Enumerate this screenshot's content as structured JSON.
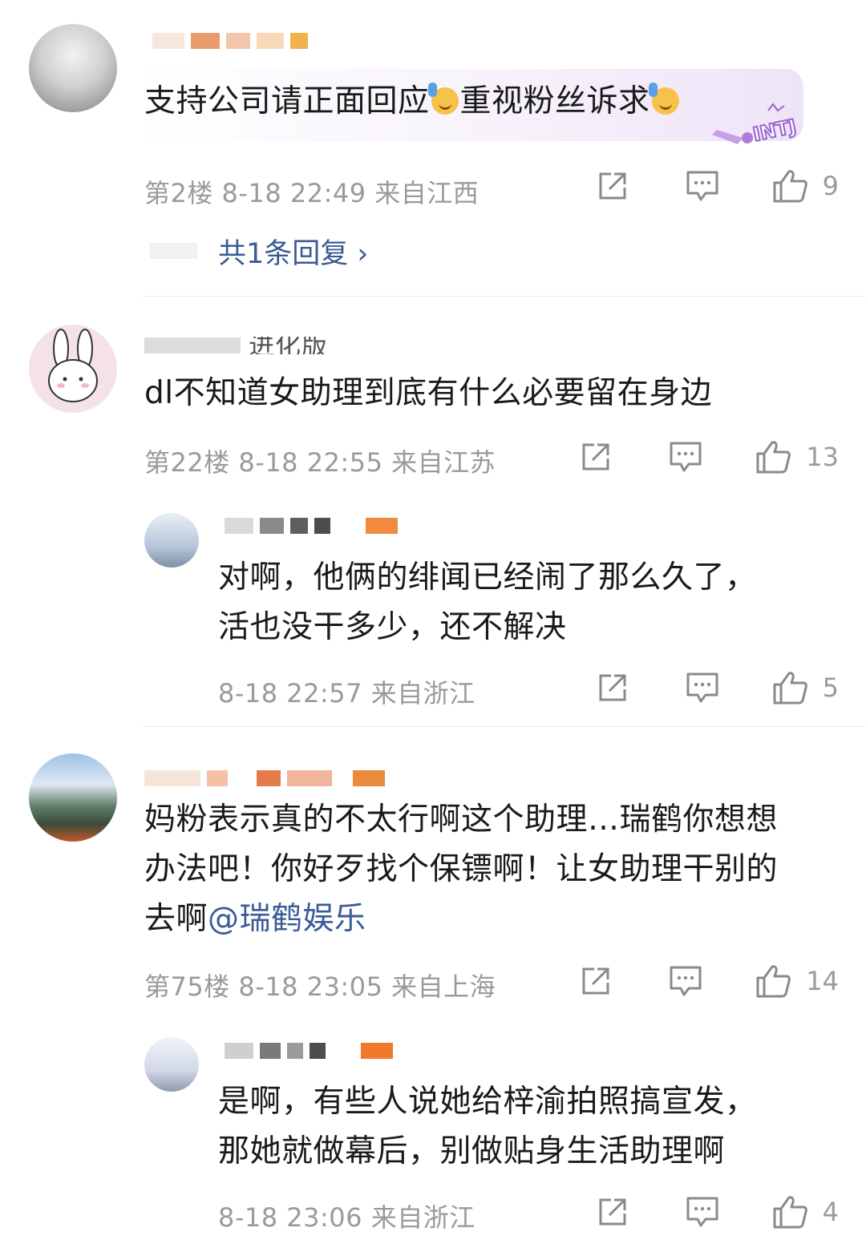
{
  "comments": [
    {
      "text_parts": [
        "支持公司请正面回应",
        "重视粉丝诉求"
      ],
      "floor": "第2楼",
      "time": "8-18 22:49",
      "location": "来自江西",
      "likes": "9",
      "reply_link": "共1条回复 ›",
      "badge": "INTJ"
    },
    {
      "username_partial": "进化版",
      "text": "dl不知道女助理到底有什么必要留在身边",
      "floor": "第22楼",
      "time": "8-18 22:55",
      "location": "来自江苏",
      "likes": "13"
    },
    {
      "text_line1": "对啊，他俩的绯闻已经闹了那么久了，",
      "text_line2": "活也没干多少，还不解决",
      "time": "8-18 22:57",
      "location": "来自浙江",
      "likes": "5"
    },
    {
      "text_line1": "妈粉表示真的不太行啊这个助理…瑞鹤你想想",
      "text_line2": "办法吧！你好歹找个保镖啊！让女助理干别的",
      "text_line3_prefix": "去啊",
      "mention": "@瑞鹤娱乐",
      "floor": "第75楼",
      "time": "8-18 23:05",
      "location": "来自上海",
      "likes": "14"
    },
    {
      "text_line1": "是啊，有些人说她给梓渝拍照搞宣发，",
      "text_line2": "那她就做幕后，别做贴身生活助理啊",
      "time": "8-18 23:06",
      "location": "来自浙江",
      "likes": "4"
    }
  ],
  "icons": [
    "share-icon",
    "comment-icon",
    "like-icon"
  ],
  "colors": {
    "link": "#3b5a96",
    "meta": "#9a9a9a",
    "text": "#1a1a1a"
  }
}
